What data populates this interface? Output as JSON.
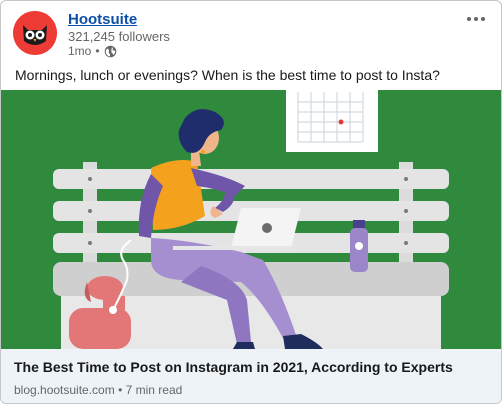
{
  "author": {
    "name": "Hootsuite",
    "followers": "321,245 followers",
    "time": "1mo",
    "separator": "•",
    "visibility_icon": "globe-icon"
  },
  "menu": {
    "icon": "more-options-icon"
  },
  "post": {
    "text": "Mornings, lunch or evenings? When is the best time to post to Insta?"
  },
  "link": {
    "title": "The Best Time to Post on Instagram in 2021, According to Experts",
    "domain": "blog.hootsuite.com",
    "separator": "•",
    "read_time": "7 min read"
  },
  "colors": {
    "brand_red": "#ef3b35",
    "link_blue": "#0a4fa8",
    "hero_green": "#2f8a3d",
    "footer_bg": "#eef3f8"
  }
}
